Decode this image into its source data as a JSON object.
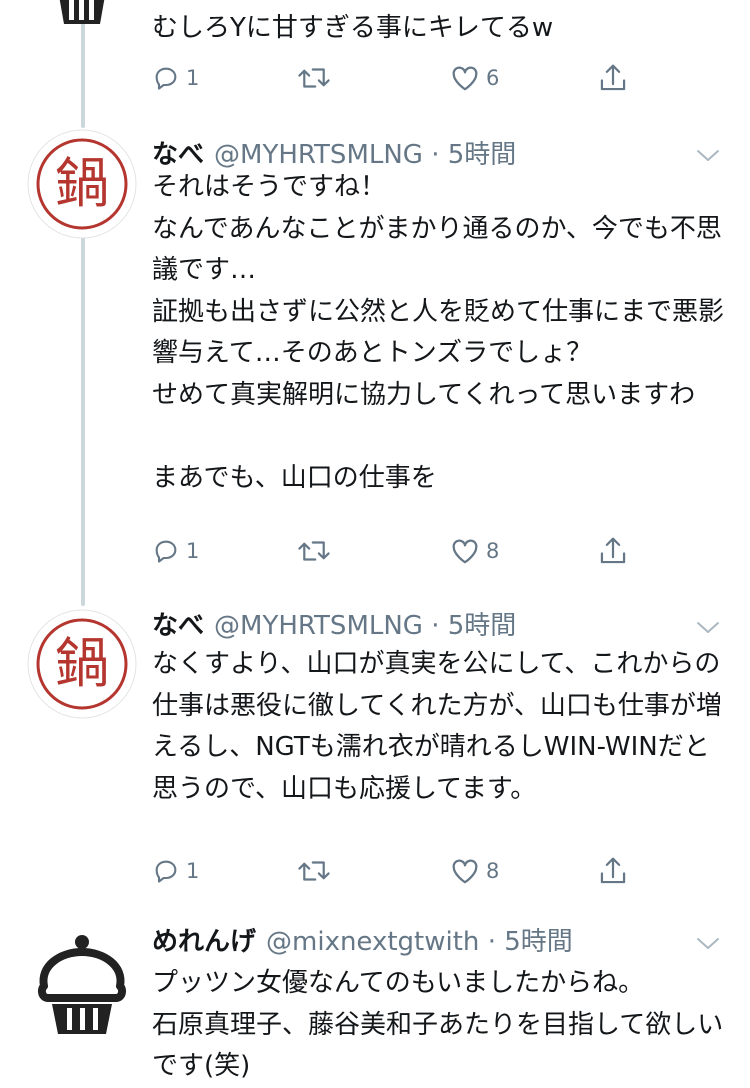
{
  "colors": {
    "thread_line": "#ccd6dd",
    "secondary_text": "#657786",
    "stamp_red": "#b5352f",
    "icon_gray": "#657786"
  },
  "top_tweet": {
    "avatar_icon": "cupcake-icon",
    "text": "むしろYに甘すぎる事にキレてるw",
    "replies": "1",
    "retweets": "",
    "likes": "6"
  },
  "tweets": [
    {
      "name": "なべ",
      "handle": "@MYHRTSMLNG",
      "sep": "·",
      "time": "5時間",
      "avatar_char": "鍋",
      "avatar_icon": "nabe-stamp-icon",
      "text": "それはそうですね！\nなんであんなことがまかり通るのか、今でも不思議です…\n証拠も出さずに公然と人を貶めて仕事にまで悪影響与えて…そのあとトンズラでしょ？\nせめて真実解明に協力してくれって思いますわ\n\nまあでも、山口の仕事を",
      "replies": "1",
      "retweets": "",
      "likes": "8"
    },
    {
      "name": "なべ",
      "handle": "@MYHRTSMLNG",
      "sep": "·",
      "time": "5時間",
      "avatar_char": "鍋",
      "avatar_icon": "nabe-stamp-icon",
      "text": "なくすより、山口が真実を公にして、これからの仕事は悪役に徹してくれた方が、山口も仕事が増えるし、NGTも濡れ衣が晴れるしWIN-WINだと思うので、山口も応援してます。",
      "replies": "1",
      "retweets": "",
      "likes": "8"
    },
    {
      "name": "めれんげ",
      "handle": "@mixnextgtwith",
      "sep": "·",
      "time": "5時間",
      "avatar_icon": "cupcake-icon",
      "text": "プッツン女優なんてのもいましたからね。\n石原真理子、藤谷美和子あたりを目指して欲しいです(笑)"
    }
  ]
}
